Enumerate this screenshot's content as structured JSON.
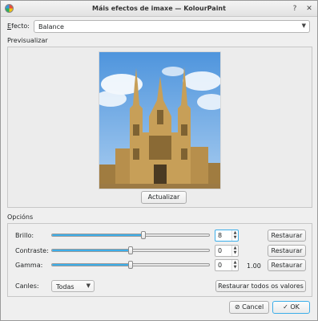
{
  "window": {
    "title": "Máis efectos de imaxe — KolourPaint"
  },
  "titlebar": {
    "help_icon": "?",
    "close_icon": "✕"
  },
  "effect": {
    "label_prefix": "E",
    "label_rest": "fecto:",
    "value": "Balance"
  },
  "preview": {
    "section_label": "Previsualizar",
    "update_button": "Actualizar"
  },
  "options": {
    "section_label": "Opcións",
    "rows": [
      {
        "label": "Brillo:",
        "slider_fraction": 0.58,
        "value": "8",
        "restore": "Restaurar"
      },
      {
        "label": "Contraste:",
        "slider_fraction": 0.5,
        "value": "0",
        "restore": "Restaurar"
      },
      {
        "label": "Gamma:",
        "slider_fraction": 0.5,
        "value": "0",
        "display": "1.00",
        "restore": "Restaurar"
      }
    ],
    "channels_label": "Canles:",
    "channels_value": "Todas",
    "restore_all": "Restaurar todos os valores"
  },
  "buttons": {
    "cancel": "Cancel",
    "ok": "OK"
  },
  "colors": {
    "accent": "#3daee9",
    "sky": "#5b9fe0",
    "stone": "#c9a866"
  }
}
